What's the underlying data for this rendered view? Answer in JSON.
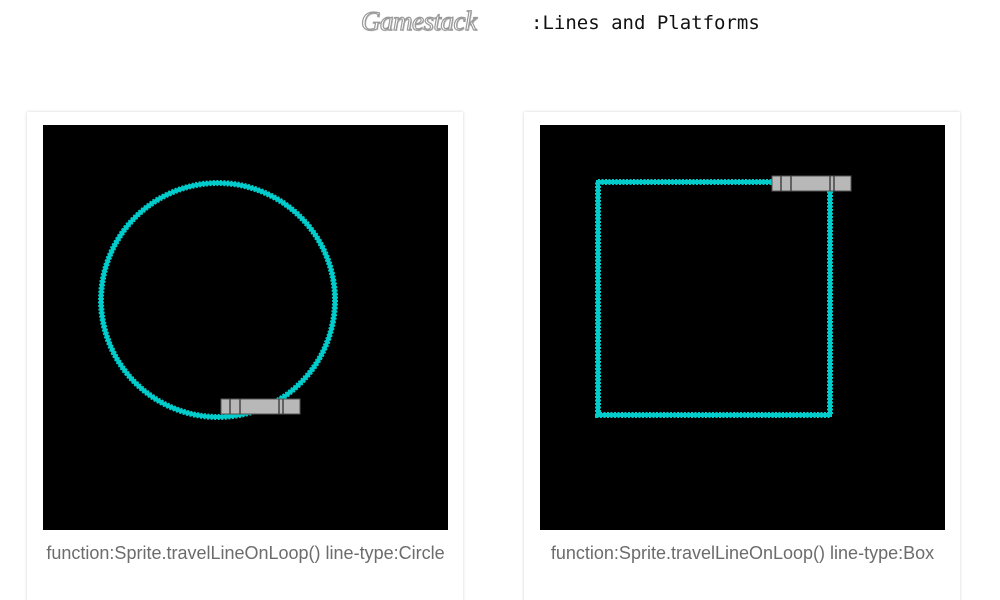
{
  "header": {
    "logo_text": "Gamestack",
    "subtitle": ":Lines and Platforms"
  },
  "demos": [
    {
      "line_type": "Circle",
      "caption": "function:Sprite.travelLineOnLoop() line-type:Circle",
      "line_color": "#00cccc",
      "platform_color": "#b8b8b8"
    },
    {
      "line_type": "Box",
      "caption": "function:Sprite.travelLineOnLoop() line-type:Box",
      "line_color": "#00cccc",
      "platform_color": "#b8b8b8"
    }
  ]
}
